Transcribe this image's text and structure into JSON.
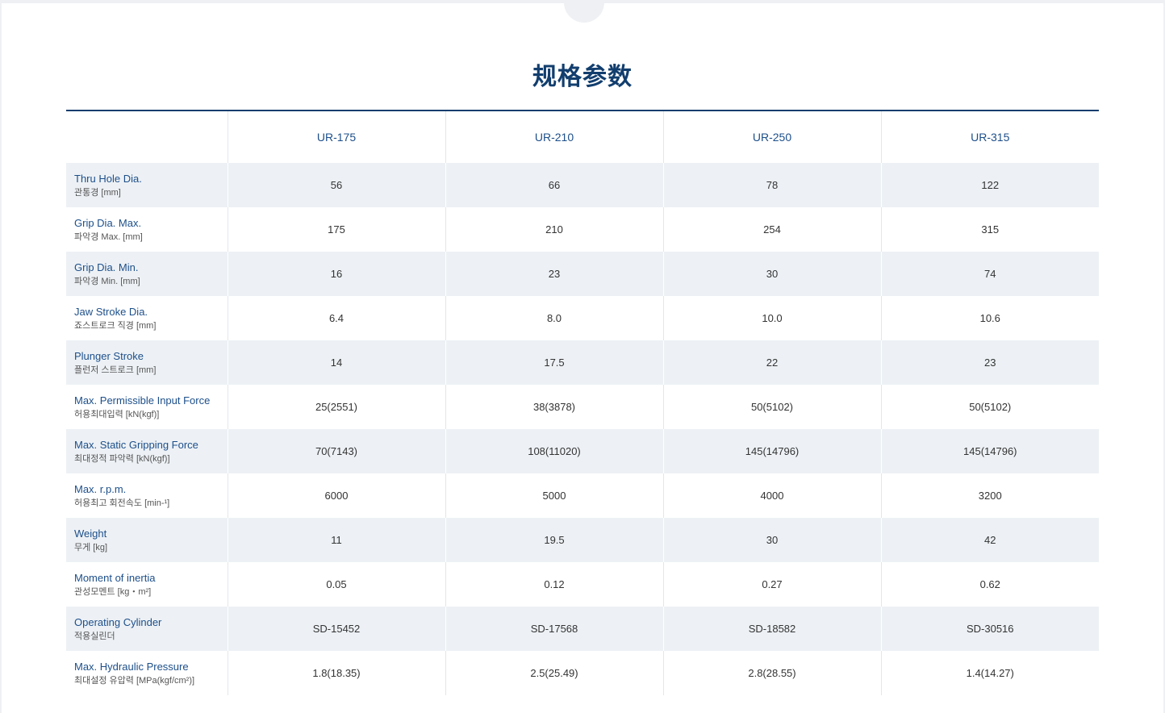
{
  "page": {
    "title": "规格参数"
  },
  "colors": {
    "title": "#123e6e",
    "accent": "#1d4f8a",
    "row_alt_bg": "#edf1f5",
    "divider": "#123e6e"
  },
  "table": {
    "models": [
      "UR-175",
      "UR-210",
      "UR-250",
      "UR-315"
    ],
    "rows": [
      {
        "en": "Thru Hole Dia.",
        "ko": "관통경 [mm]",
        "values": [
          "56",
          "66",
          "78",
          "122"
        ]
      },
      {
        "en": "Grip Dia. Max.",
        "ko": "파악경 Max. [mm]",
        "values": [
          "175",
          "210",
          "254",
          "315"
        ]
      },
      {
        "en": "Grip Dia. Min.",
        "ko": "파악경 Min. [mm]",
        "values": [
          "16",
          "23",
          "30",
          "74"
        ]
      },
      {
        "en": "Jaw Stroke Dia.",
        "ko": "죠스트로크 직경 [mm]",
        "values": [
          "6.4",
          "8.0",
          "10.0",
          "10.6"
        ]
      },
      {
        "en": "Plunger Stroke",
        "ko": "플런저 스트로크 [mm]",
        "values": [
          "14",
          "17.5",
          "22",
          "23"
        ]
      },
      {
        "en": "Max. Permissible Input Force",
        "ko": "허용최대입력 [kN(kgf)]",
        "values": [
          "25(2551)",
          "38(3878)",
          "50(5102)",
          "50(5102)"
        ]
      },
      {
        "en": "Max. Static Gripping Force",
        "ko": "최대정적 파악력 [kN(kgf)]",
        "values": [
          "70(7143)",
          "108(11020)",
          "145(14796)",
          "145(14796)"
        ]
      },
      {
        "en": "Max. r.p.m.",
        "ko": "허용최고 회전속도 [min-¹]",
        "values": [
          "6000",
          "5000",
          "4000",
          "3200"
        ]
      },
      {
        "en": "Weight",
        "ko": "무게 [kg]",
        "values": [
          "11",
          "19.5",
          "30",
          "42"
        ]
      },
      {
        "en": "Moment of inertia",
        "ko": "관성모멘트 [kg・m²]",
        "values": [
          "0.05",
          "0.12",
          "0.27",
          "0.62"
        ]
      },
      {
        "en": "Operating Cylinder",
        "ko": "적용실린더",
        "values": [
          "SD-15452",
          "SD-17568",
          "SD-18582",
          "SD-30516"
        ]
      },
      {
        "en": "Max. Hydraulic Pressure",
        "ko": "최대설정 유압력 [MPa(kgf/cm²)]",
        "values": [
          "1.8(18.35)",
          "2.5(25.49)",
          "2.8(28.55)",
          "1.4(14.27)"
        ]
      }
    ]
  }
}
